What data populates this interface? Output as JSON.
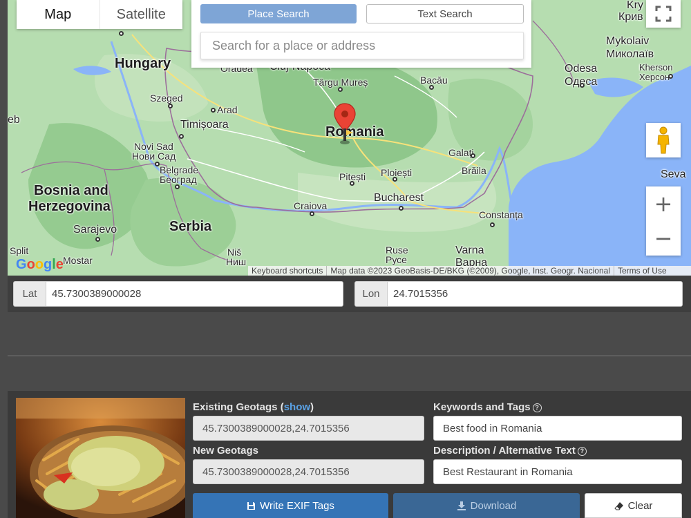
{
  "map": {
    "type_options": [
      "Map",
      "Satellite"
    ],
    "active_type": "Map",
    "place_search_label": "Place Search",
    "text_search_label": "Text Search",
    "search_placeholder": "Search for a place or address",
    "labels": {
      "hungary": "Hungary",
      "romania": "Romania",
      "serbia": "Serbia",
      "bosnia_1": "Bosnia and",
      "bosnia_2": "Herzegovina",
      "szeged": "Szeged",
      "arad": "Arad",
      "timisoara": "Timișoara",
      "novi_sad_1": "Novi Sad",
      "novi_sad_2": "Нови Сад",
      "belgrade_1": "Belgrade",
      "belgrade_2": "Београд",
      "sarajevo": "Sarajevo",
      "split": "Split",
      "mostar": "Mostar",
      "nis_1": "Niš",
      "nis_2": "Ниш",
      "oradea": "Oradea",
      "cluj": "Cluj-Napoca",
      "targu": "Târgu Mureș",
      "bacau": "Bacău",
      "galati": "Galați",
      "braila": "Brăila",
      "ploiesti": "Ploiești",
      "pitesti": "Pitești",
      "craiova": "Craiova",
      "bucharest": "Bucharest",
      "constanta": "Constanța",
      "ruse_1": "Ruse",
      "ruse_2": "Русе",
      "varna_1": "Varna",
      "varna_2": "Варна",
      "mykolaiv_1": "Mykolaiv",
      "mykolaiv_2": "Миколаїв",
      "odesa_1": "Odesa",
      "odesa_2": "Одеса",
      "kherson_1": "Kherson",
      "kherson_2": "Херсон",
      "kryvyi_1": "Kry",
      "kryvyi_2": "Крив",
      "seva": "Seva",
      "eb": "eb"
    },
    "attribution": [
      "Keyboard shortcuts",
      "Map data ©2023 GeoBasis-DE/BKG (©2009), Google, Inst. Geogr. Nacional",
      "Terms of Use"
    ],
    "zoom_in": "+",
    "zoom_out": "−"
  },
  "coords": {
    "lat_label": "Lat",
    "lat_value": "45.7300389000028",
    "lon_label": "Lon",
    "lon_value": "24.7015356"
  },
  "geotag": {
    "existing_label": "Existing Geotags (",
    "show_link": "show",
    "existing_close": ")",
    "existing_value": "45.7300389000028,24.7015356",
    "new_label": "New Geotags",
    "new_value": "45.7300389000028,24.7015356",
    "keywords_label": "Keywords and Tags",
    "keywords_value": "Best food in Romania",
    "description_label": "Description / Alternative Text",
    "description_value": "Best Restaurant in Romania",
    "write_label": "Write EXIF Tags",
    "download_label": "Download",
    "clear_label": "Clear"
  },
  "colors": {
    "primary": "#3574b6",
    "link": "#5aa2e6",
    "map_land": "#a7d6a3",
    "map_sea": "#8ab4f8"
  }
}
